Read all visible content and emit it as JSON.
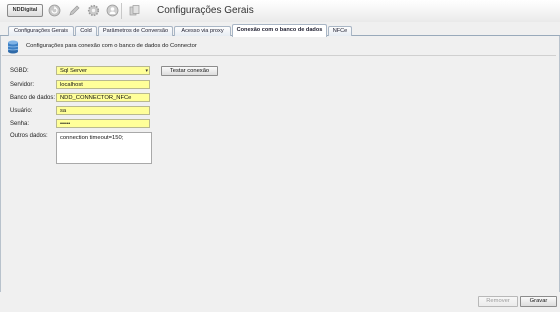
{
  "header": {
    "logo_text": "NDDigital",
    "title": "Configurações Gerais",
    "toolbar_icons": [
      "refresh-icon",
      "pencil-icon",
      "gear-icon",
      "user-icon",
      "copy-icon"
    ]
  },
  "tabs": [
    {
      "label": "Configurações Gerais",
      "active": false
    },
    {
      "label": "Cold",
      "active": false
    },
    {
      "label": "Parâmetros de Conversão",
      "active": false
    },
    {
      "label": "Acesso via proxy",
      "active": false
    },
    {
      "label": "Conexão com o banco de dados",
      "active": true
    },
    {
      "label": "NFCe",
      "active": false
    }
  ],
  "info": {
    "text": "Configurações para conexão com o banco de dados do Connector",
    "icon": "database-icon"
  },
  "form": {
    "sgbd": {
      "label": "SGBD:",
      "value": "Sql Server"
    },
    "servidor": {
      "label": "Servidor:",
      "value": "localhost"
    },
    "banco": {
      "label": "Banco de dados:",
      "value": "NDD_CONNECTOR_NFCe"
    },
    "usuario": {
      "label": "Usuário:",
      "value": "sa"
    },
    "senha": {
      "label": "Senha:",
      "value": "•••••"
    },
    "outros": {
      "label": "Outros dados:",
      "value": "connection timeout=150;"
    },
    "test_button": "Testar conexão"
  },
  "footer": {
    "remove_label": "Remover",
    "save_label": "Gravar"
  },
  "colors": {
    "field_bg": "#ffff99",
    "tab_border": "#a9b6c5"
  }
}
